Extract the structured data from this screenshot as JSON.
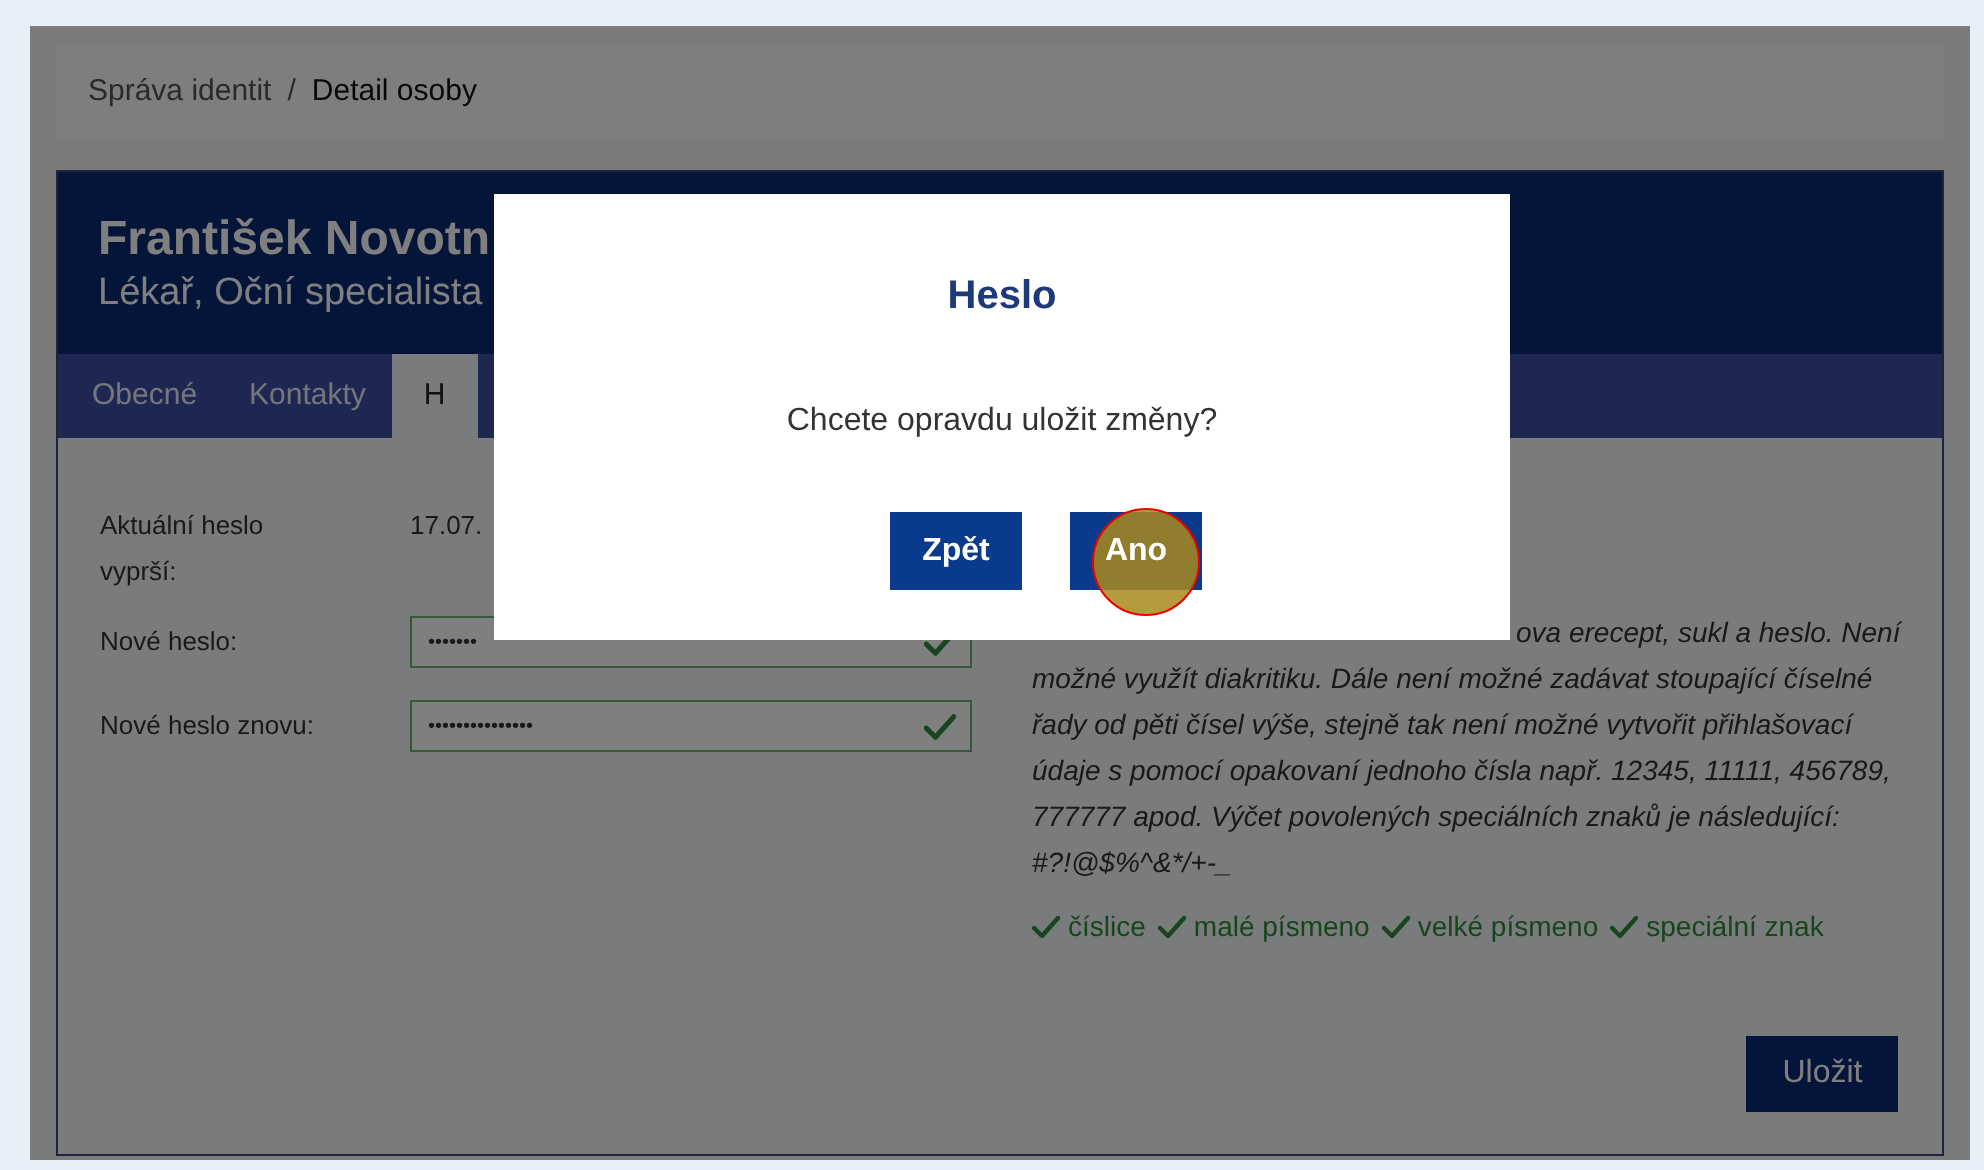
{
  "breadcrumb": {
    "items": [
      "Správa identit",
      "Detail osoby"
    ],
    "separator": "/"
  },
  "person": {
    "name": "František Novotn",
    "role": "Lékař, Oční specialista"
  },
  "tabs": [
    {
      "label": "Obecné",
      "selected": false
    },
    {
      "label": "Kontakty",
      "selected": false
    },
    {
      "label": "H",
      "selected": true
    }
  ],
  "form": {
    "expiry_label": "Aktuální heslo vyprší:",
    "expiry_value": "17.07.",
    "fields": [
      {
        "label": "Nové heslo:",
        "value": "•••••••",
        "valid": true
      },
      {
        "label": "Nové heslo znovu:",
        "value": "•••••••••••••••",
        "valid": true
      }
    ]
  },
  "hint_lines": [
    "ova erecept, sukl a heslo. Není",
    "možné využít diakritiku. Dále není možné zadávat stoupající číselné",
    "řady od pěti čísel výše, stejně tak není možné vytvořit přihlašovací",
    "údaje s pomocí opakovaní jednoho čísla např. 12345, 11111, 456789,",
    "777777 apod. Výčet povolených speciálních znaků je následující:",
    "#?!@$%^&*/+-_"
  ],
  "requirements": [
    {
      "label": "číslice",
      "met": true
    },
    {
      "label": "malé písmeno",
      "met": true
    },
    {
      "label": "velké písmeno",
      "met": true
    },
    {
      "label": "speciální znak",
      "met": true
    }
  ],
  "save_button": "Uložit",
  "dialog": {
    "title": "Heslo",
    "message": "Chcete opravdu uložit změny?",
    "buttons": [
      {
        "label": "Zpět",
        "pressed": false
      },
      {
        "label": "Ano",
        "pressed": true
      }
    ]
  }
}
